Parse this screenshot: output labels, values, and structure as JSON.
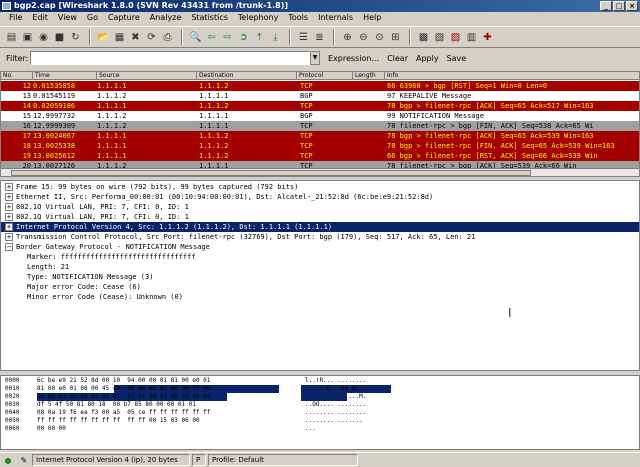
{
  "window": {
    "title": "bgp2.cap  [Wireshark 1.8.0  (SVN Rev 43431 from /trunk-1.8)]"
  },
  "menu": [
    "File",
    "Edit",
    "View",
    "Go",
    "Capture",
    "Analyze",
    "Statistics",
    "Telephony",
    "Tools",
    "Internals",
    "Help"
  ],
  "filter": {
    "label": "Filter:",
    "value": "",
    "expression": "Expression...",
    "clear": "Clear",
    "apply": "Apply",
    "save": "Save"
  },
  "packet_list": {
    "columns": [
      "No.",
      "Time",
      "Source",
      "Destination",
      "Protocol",
      "Length",
      "Info"
    ],
    "rows": [
      {
        "no": "12",
        "time": "0.01535858",
        "src": "1.1.1.1",
        "dst": "1.1.1.2",
        "proto": "TCP",
        "len": "",
        "info": "66 63960 > bgp [RST] Seq=1 Win=0 Len=0",
        "style": "red"
      },
      {
        "no": "13",
        "time": "0.01545119",
        "src": "1.1.1.2",
        "dst": "1.1.1.1",
        "proto": "BGP",
        "len": "",
        "info": "97 KEEPALIVE Message",
        "style": "white"
      },
      {
        "no": "14",
        "time": "0.02059186",
        "src": "1.1.1.1",
        "dst": "1.1.1.2",
        "proto": "TCP",
        "len": "",
        "info": "78 bgp > filenet-rpc [ACK] Seq=65 Ack=517 Win=163",
        "style": "red"
      },
      {
        "no": "15",
        "time": "12.9997732",
        "src": "1.1.1.2",
        "dst": "1.1.1.1",
        "proto": "BGP",
        "len": "",
        "info": "99 NOTIFICATION Message",
        "style": "white"
      },
      {
        "no": "16",
        "time": "12.9999309",
        "src": "1.1.1.2",
        "dst": "1.1.1.1",
        "proto": "TCP",
        "len": "",
        "info": "78 filenet-rpc > bgp [FIN, ACK] Seq=538 Ack=65 Wi",
        "style": "gray"
      },
      {
        "no": "17",
        "time": "13.0024067",
        "src": "1.1.1.1",
        "dst": "1.1.1.2",
        "proto": "TCP",
        "len": "",
        "info": "78 bgp > filenet-rpc [ACK] Seq=65 Ack=539 Win=163",
        "style": "red"
      },
      {
        "no": "18",
        "time": "13.0025338",
        "src": "1.1.1.1",
        "dst": "1.1.1.2",
        "proto": "TCP",
        "len": "",
        "info": "78 bgp > filenet-rpc [FIN, ACK] Seq=65 Ack=539 Win=163",
        "style": "red"
      },
      {
        "no": "19",
        "time": "13.0025612",
        "src": "1.1.1.1",
        "dst": "1.1.1.2",
        "proto": "TCP",
        "len": "",
        "info": "66 bgp > filenet-rpc [RST, ACK] Seq=66 Ack=539 Win",
        "style": "red"
      },
      {
        "no": "20",
        "time": "13.0027126",
        "src": "1.1.1.2",
        "dst": "1.1.1.1",
        "proto": "TCP",
        "len": "",
        "info": "78 filenet-rpc > bgp [ACK] Seq=539 Ack=66 Win",
        "style": "gray"
      }
    ]
  },
  "details": [
    {
      "text": "Frame 15: 99 bytes on wire (792 bits), 99 bytes captured (792 bits)",
      "level": 0,
      "exp": "+"
    },
    {
      "text": "Ethernet II, Src: Performa_00:00:01 (00:10:94:00:00:01), Dst: Alcatel-_21:52:8d (6c:be:e9:21:52:8d)",
      "level": 0,
      "exp": "+"
    },
    {
      "text": "802.1Q Virtual LAN, PRI: 7, CFI: 0, ID: 1",
      "level": 0,
      "exp": "+"
    },
    {
      "text": "802.1Q Virtual LAN, PRI: 7, CFI: 0, ID: 1",
      "level": 0,
      "exp": "+"
    },
    {
      "text": "Internet Protocol Version 4, Src: 1.1.1.2 (1.1.1.2), Dst: 1.1.1.1 (1.1.1.1)",
      "level": 0,
      "exp": "+",
      "sel": true
    },
    {
      "text": "Transmission Control Protocol, Src Port: filenet-rpc (32769), Dst Port: bgp (179), Seq: 517, Ack: 65, Len: 21",
      "level": 0,
      "exp": "+"
    },
    {
      "text": "Border Gateway Protocol - NOTIFICATION Message",
      "level": 0,
      "exp": "−"
    },
    {
      "text": "Marker: ffffffffffffffffffffffffffffffff",
      "level": 1
    },
    {
      "text": "Length: 21",
      "level": 1
    },
    {
      "text": "Type: NOTIFICATION Message (3)",
      "level": 1
    },
    {
      "text": "Major error Code: Cease (6)",
      "level": 1
    },
    {
      "text": "Minor error Code (Cease): Unknown (0)",
      "level": 1
    }
  ],
  "bytes": [
    {
      "off": "0000",
      "hex": "6c be e9 21 52 8d 00 10  94 00 00 01 81 00 e0 01",
      "ascii": "l..!R... ........"
    },
    {
      "off": "0010",
      "hex": "81 00 e0 01 08 00 45 c0  00 49 65 8a 40 00 ff 06",
      "ascii": "......E. .Ie.@..."
    },
    {
      "off": "0020",
      "hex": "11 60 01 01 01 02 01 01  01 01 80 01 00 b3 4d 04",
      "ascii": ".`...... ......M."
    },
    {
      "off": "0030",
      "hex": "df 5 4f 50 81 80 18  00 b7 85 80 00 00 01 01",
      "ascii": "..OO.... ........"
    },
    {
      "off": "0040",
      "hex": "08 0a 19 f6 ea f3 00 a5  05 ce ff ff ff ff ff ff",
      "ascii": "........ ........"
    },
    {
      "off": "0050",
      "hex": "ff ff ff ff ff ff ff ff  ff ff 00 15 03 06 00",
      "ascii": "........ ......."
    },
    {
      "off": "0060",
      "hex": "00 00 00",
      "ascii": "..."
    }
  ],
  "status": {
    "field": "Internet Protocol Version 4 (ip), 20 bytes",
    "mode": "P",
    "profile": "Profile: Default"
  },
  "colors": {
    "red_row": "#a40000",
    "red_row_text": "#fff200",
    "selection": "#0a246a"
  }
}
